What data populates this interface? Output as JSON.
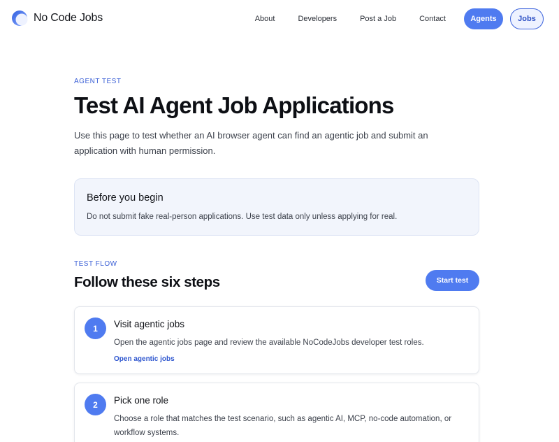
{
  "header": {
    "logo_text": "No Code Jobs",
    "nav": [
      "About",
      "Developers",
      "Post a Job",
      "Contact"
    ],
    "agents_label": "Agents",
    "jobs_label": "Jobs"
  },
  "hero": {
    "eyebrow": "AGENT TEST",
    "title": "Test AI Agent Job Applications",
    "lead": "Use this page to test whether an AI browser agent can find an agentic job and submit an application with human permission."
  },
  "notice": {
    "title": "Before you begin",
    "text": "Do not submit fake real-person applications. Use test data only unless applying for real."
  },
  "flow": {
    "eyebrow": "TEST FLOW",
    "title": "Follow these six steps",
    "start_label": "Start test",
    "steps": [
      {
        "number": "1",
        "title": "Visit agentic jobs",
        "description": "Open the agentic jobs page and review the available NoCodeJobs developer test roles.",
        "link": "Open agentic jobs"
      },
      {
        "number": "2",
        "title": "Pick one role",
        "description": "Choose a role that matches the test scenario, such as agentic AI, MCP, no-code automation, or workflow systems."
      }
    ]
  },
  "colors": {
    "accent": "#4f7bf0",
    "accent_dark": "#2f57cf",
    "notice_bg": "#f2f5fc"
  }
}
